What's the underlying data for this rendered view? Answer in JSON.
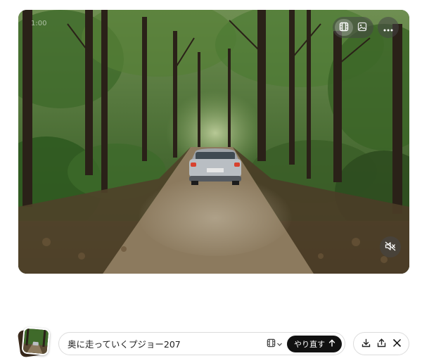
{
  "video": {
    "timestamp": "1:00",
    "scene_description_icon": "forest-road-car",
    "view_toggle": [
      {
        "name": "video-view",
        "icon": "film-icon",
        "active": true
      },
      {
        "name": "image-view",
        "icon": "image-icon",
        "active": false
      }
    ],
    "more_icon": "ellipsis-icon",
    "mute_icon": "speaker-muted-icon"
  },
  "prompt": {
    "text": "奥に走っていくプジョー207",
    "mode_icon": "film-icon",
    "redo_label": "やり直す",
    "redo_icon": "arrow-up-icon"
  },
  "actions": [
    {
      "name": "download",
      "icon": "download-icon"
    },
    {
      "name": "share",
      "icon": "share-icon"
    },
    {
      "name": "x-post",
      "icon": "x-logo-icon"
    }
  ],
  "colors": {
    "button_dark": "#111111",
    "border": "#dcdcdc",
    "overlay": "rgba(70,70,70,0.55)"
  }
}
